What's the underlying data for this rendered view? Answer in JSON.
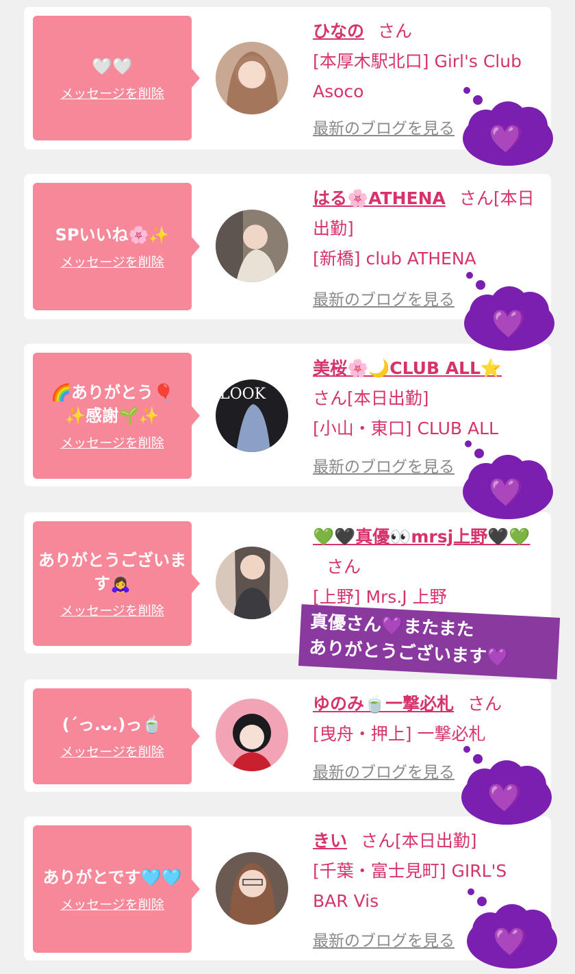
{
  "delete_label": "メッセージを削除",
  "blog_label": "最新のブログを見る",
  "san_label": "さん",
  "colors": {
    "bubble": "#f7889a",
    "accent": "#d6336c",
    "cloud": "#7a1fb0",
    "sticker": "#8a3a9e"
  },
  "cards": [
    {
      "message": "🤍🤍",
      "name": "ひなの",
      "status": "",
      "shop": "[本厚木駅北口] Girl's Club Asoco"
    },
    {
      "message": "SPいいね🌸✨",
      "name": "はる🌸ATHENA",
      "status": "[本日出勤]",
      "shop": "[新橋] club ATHENA"
    },
    {
      "message": "🌈ありがとう🎈 ✨感謝🌱✨",
      "name": "美桜🌸🌙CLUB ALL⭐",
      "status": "[本日出勤]",
      "shop": "[小山・東口] CLUB ALL"
    },
    {
      "message": "ありがとうございます🙇‍♀️",
      "name": "💚🖤真優👀mrsj上野🖤💚",
      "status": "",
      "shop": "[上野] Mrs.J 上野"
    },
    {
      "message": "(ˊっ.ᴗ.)っ🍵",
      "name": "ゆのみ🍵一撃必札",
      "status": "",
      "shop": "[曳舟・押上] 一撃必札"
    },
    {
      "message": "ありがとです🩵🩵",
      "name": "きい",
      "status": "[本日出勤]",
      "shop": "[千葉・富士見町] GIRL'S BAR Vis"
    }
  ],
  "sticker": {
    "line1": "真優さん💜またまた",
    "line2": "ありがとうございます💜"
  },
  "heart_emoji": "💜"
}
